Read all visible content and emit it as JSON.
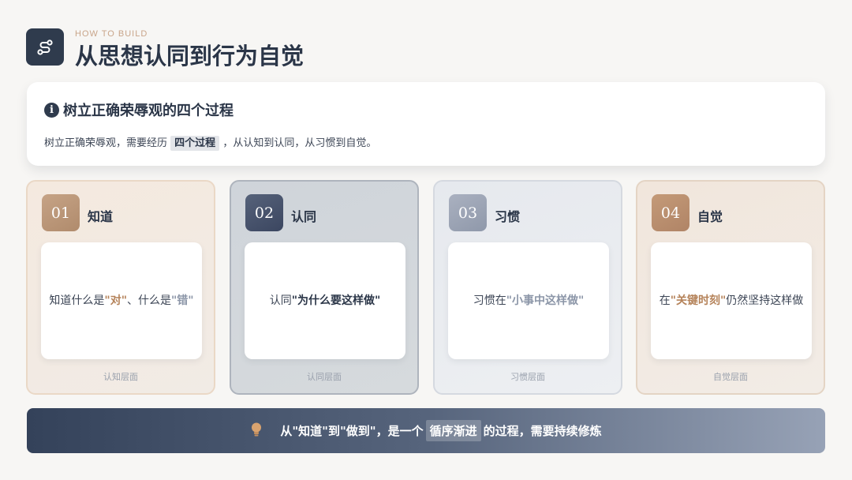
{
  "header": {
    "subtitle": "HOW TO BUILD",
    "title": "从思想认同到行为自觉",
    "icon": "route-icon"
  },
  "intro": {
    "icon": "info-icon",
    "title": "树立正确荣辱观的四个过程",
    "text_before": "树立正确荣辱观，需要经历",
    "highlight": "四个过程",
    "text_after": "，从认知到认同，从习惯到自觉。"
  },
  "stages": [
    {
      "number": "01",
      "title": "知道",
      "text_a": "知道什么是",
      "em_a": "\"对\"",
      "text_b": "、什么是",
      "em_b": "\"错\"",
      "footer": "认知层面"
    },
    {
      "number": "02",
      "title": "认同",
      "text_a": "认同",
      "em_a": "\"为什么要这样做\"",
      "footer": "认同层面"
    },
    {
      "number": "03",
      "title": "习惯",
      "text_a": "习惯在",
      "em_a": "\"小事中这样做\"",
      "footer": "习惯层面"
    },
    {
      "number": "04",
      "title": "自觉",
      "text_a": "在",
      "em_a": "\"关键时刻\"",
      "text_b": "仍然坚持这样做",
      "footer": "自觉层面"
    }
  ],
  "footer": {
    "icon": "lightbulb-icon",
    "text_before": "从\"知道\"到\"做到\"，是一个",
    "highlight": "循序渐进",
    "text_after": "的过程，需要持续修炼"
  },
  "colors": {
    "navy": "#2f3b4d",
    "brown_accent": "#b5835a",
    "slate_accent": "#8c96a8"
  }
}
